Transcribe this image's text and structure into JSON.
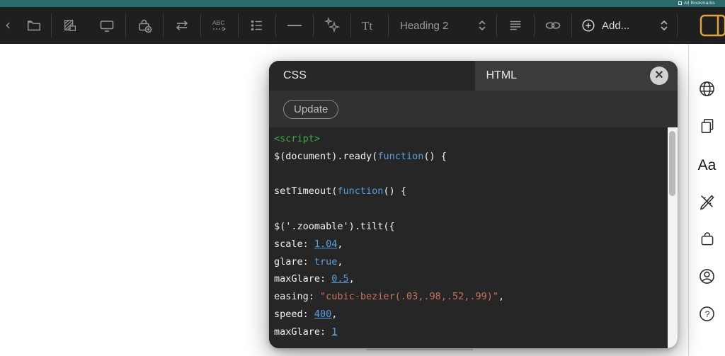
{
  "menubar": {
    "right_label": "All Bookmarks"
  },
  "toolbar": {
    "heading_select_value": "Heading 2",
    "add_label": "Add...",
    "abc_icon_text": "ABC",
    "text_style_icon_text": "Tt",
    "icons": [
      "back-chevron",
      "folder",
      "hatched-page",
      "display",
      "lock-add",
      "swap-arrows",
      "spellcheck-abc",
      "bullet-list",
      "horizontal-rule",
      "sparkle-stars",
      "text-style",
      "heading-select",
      "align-lines",
      "link-chain",
      "add-circle-plus",
      "updown-chevrons",
      "yellow-bookmark"
    ]
  },
  "modal": {
    "tabs": [
      {
        "label": "CSS",
        "active": true
      },
      {
        "label": "HTML",
        "active": false
      }
    ],
    "update_label": "Update",
    "close_glyph": "✕"
  },
  "code": {
    "language": "javascript",
    "lines": [
      [
        {
          "t": "<script>",
          "c": "green"
        }
      ],
      [
        {
          "t": "$(document).ready(",
          "c": "plain"
        },
        {
          "t": "function",
          "c": "blue"
        },
        {
          "t": "() {",
          "c": "plain"
        }
      ],
      [],
      [
        {
          "t": "setTimeout(",
          "c": "plain"
        },
        {
          "t": "function",
          "c": "blue"
        },
        {
          "t": "() {",
          "c": "plain"
        }
      ],
      [],
      [
        {
          "t": "$('.zoomable').tilt({",
          "c": "plain"
        }
      ],
      [
        {
          "t": "scale: ",
          "c": "plain"
        },
        {
          "t": "1.04",
          "c": "num"
        },
        {
          "t": ",",
          "c": "plain"
        }
      ],
      [
        {
          "t": "glare: ",
          "c": "plain"
        },
        {
          "t": "true",
          "c": "blue"
        },
        {
          "t": ",",
          "c": "plain"
        }
      ],
      [
        {
          "t": "maxGlare: ",
          "c": "plain"
        },
        {
          "t": "0.5",
          "c": "num"
        },
        {
          "t": ",",
          "c": "plain"
        }
      ],
      [
        {
          "t": "easing: ",
          "c": "plain"
        },
        {
          "t": "\"cubic-bezier(.03,.98,.52,.99)\"",
          "c": "str"
        },
        {
          "t": ",",
          "c": "plain"
        }
      ],
      [
        {
          "t": "speed: ",
          "c": "plain"
        },
        {
          "t": "400",
          "c": "num"
        },
        {
          "t": ",",
          "c": "plain"
        }
      ],
      [
        {
          "t": "maxGlare: ",
          "c": "plain"
        },
        {
          "t": "1",
          "c": "num"
        }
      ]
    ]
  },
  "sidebar": {
    "icons": [
      "globe",
      "pages",
      "text-aa",
      "design-tools",
      "bag",
      "account",
      "help"
    ],
    "text_aa_label": "Aa",
    "help_glyph": "?"
  },
  "colors": {
    "teal_bar": "#2a6b6b",
    "toolbar_bg": "#1f1f1f",
    "modal_header": "#3b3b3b",
    "modal_tab_active": "#272727",
    "code_bg": "#262626",
    "syntax_green": "#3ead3e",
    "syntax_blue": "#5aa0dc",
    "syntax_string_red": "#ca7160",
    "accent_yellow": "#e2a63c"
  }
}
